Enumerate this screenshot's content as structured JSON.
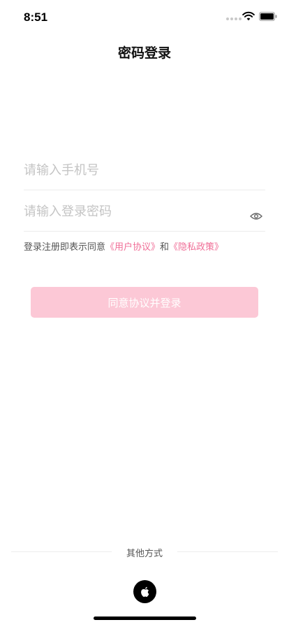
{
  "status_bar": {
    "time": "8:51"
  },
  "header": {
    "title": "密码登录"
  },
  "form": {
    "phone_placeholder": "请输入手机号",
    "password_placeholder": "请输入登录密码"
  },
  "agreement": {
    "prefix": "登录注册即表示同意",
    "user_agreement": "《用户协议》",
    "conjunction": "和",
    "privacy_policy": "《隐私政策》",
    "link_color": "#f06e97"
  },
  "login_button": {
    "label": "同意协议并登录",
    "color": "#fcc8d6"
  },
  "other_methods": {
    "label": "其他方式",
    "providers": [
      "apple-icon"
    ]
  }
}
